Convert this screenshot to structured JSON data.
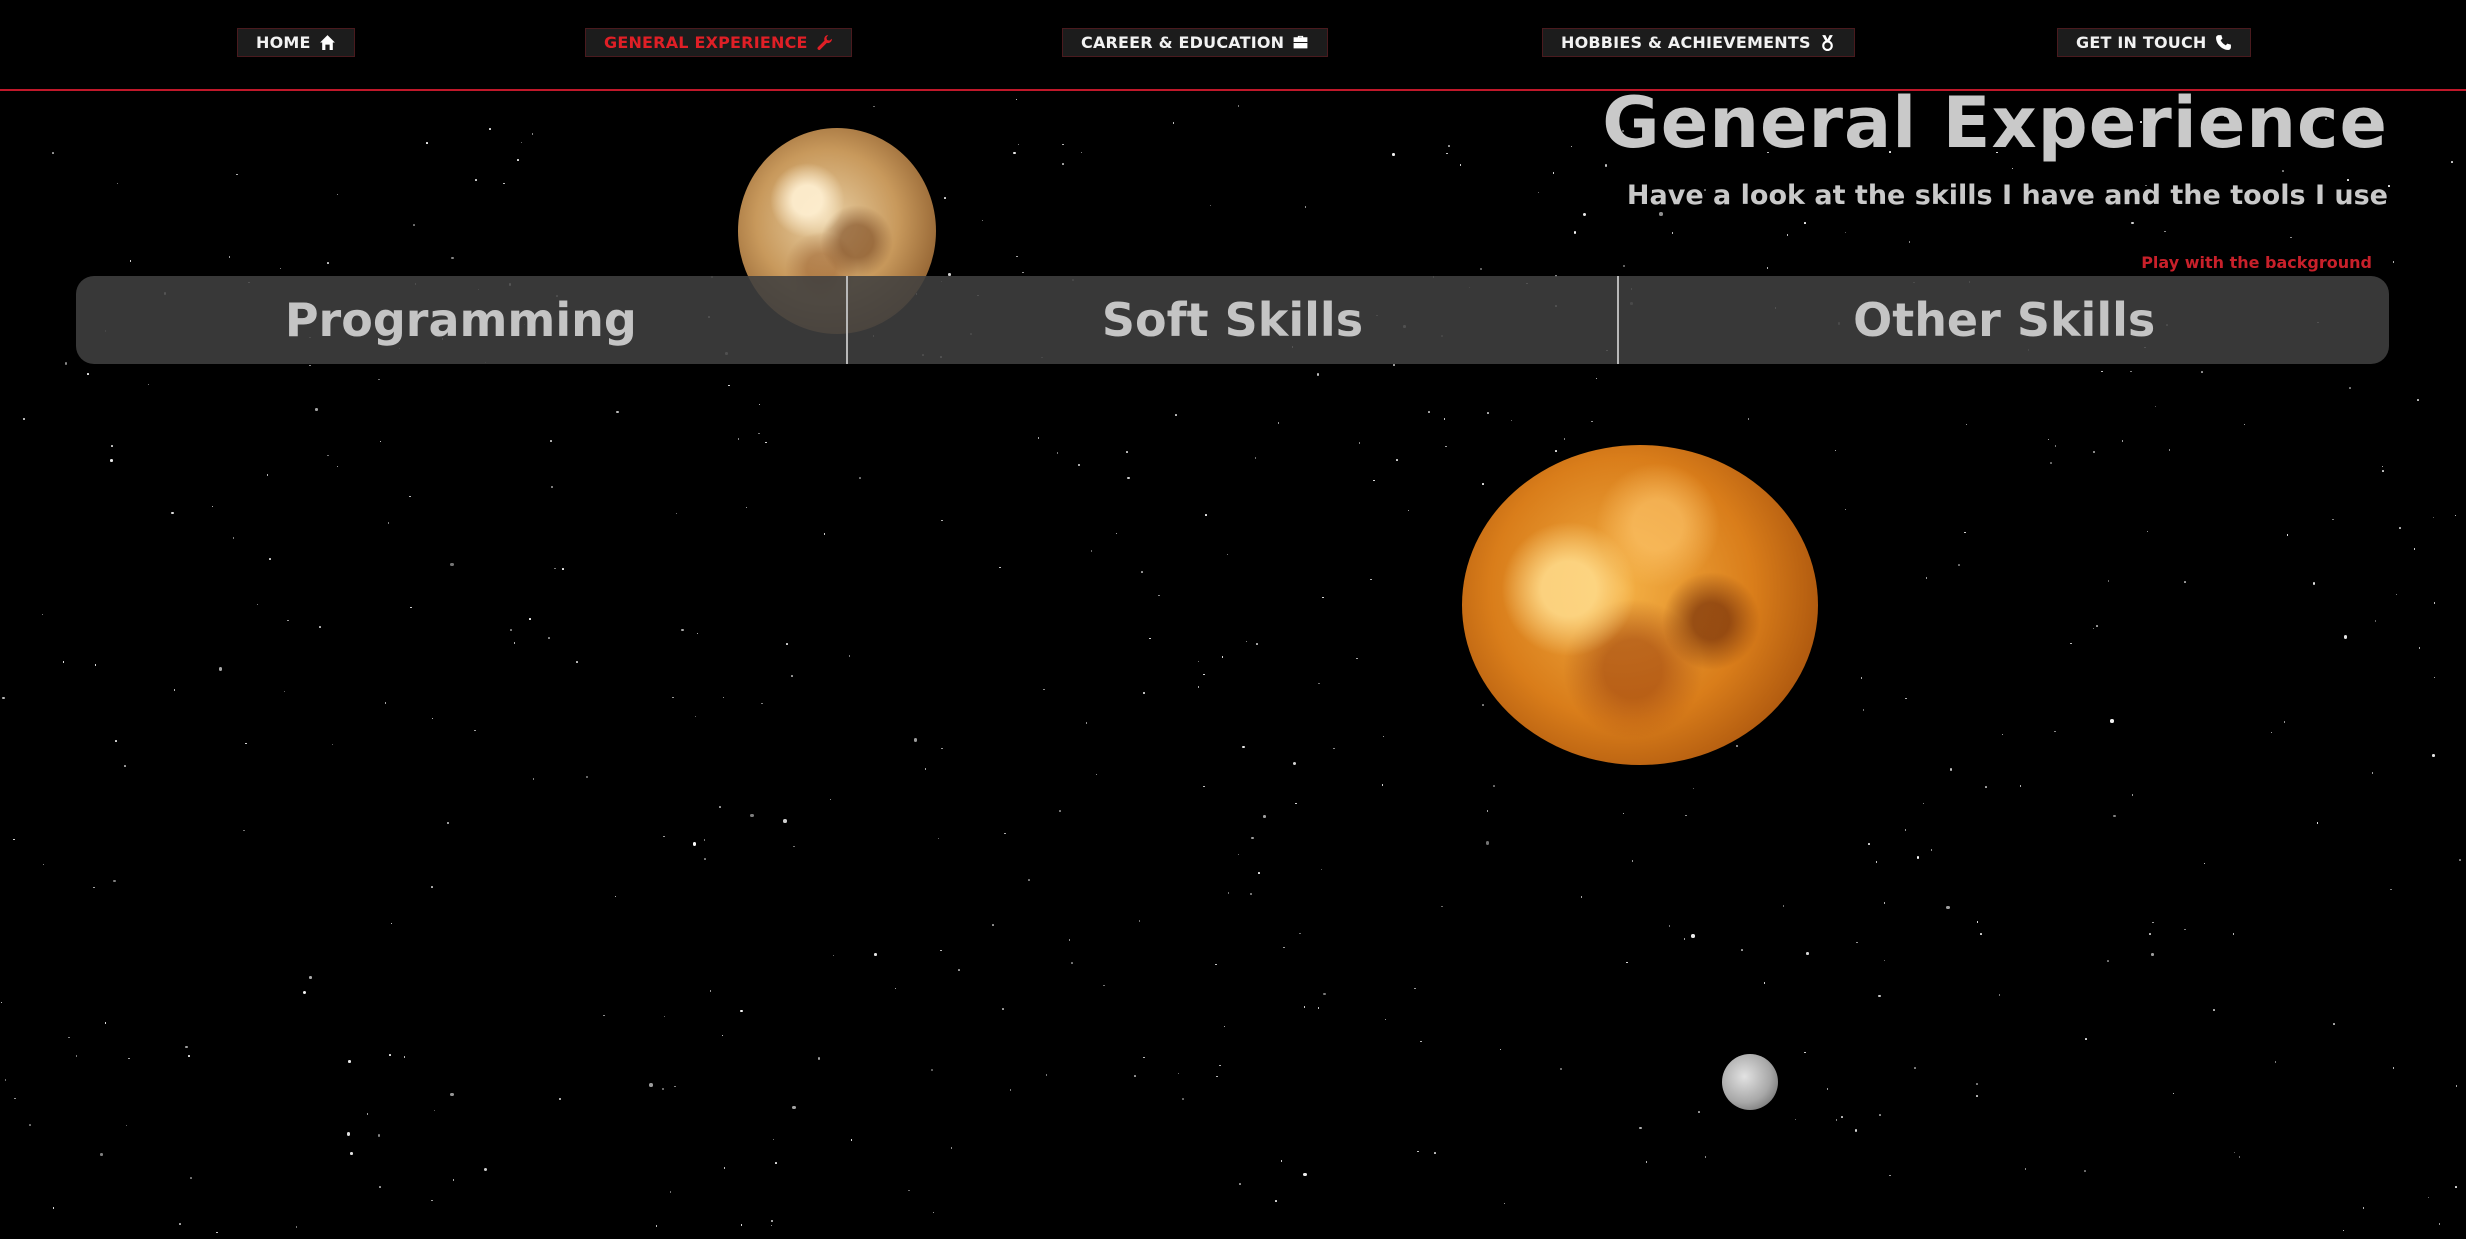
{
  "nav": {
    "items": [
      {
        "label": "HOME",
        "icon": "home-icon",
        "active": false
      },
      {
        "label": "GENERAL EXPERIENCE",
        "icon": "wrench-icon",
        "active": true
      },
      {
        "label": "CAREER & EDUCATION",
        "icon": "briefcase-icon",
        "active": false
      },
      {
        "label": "HOBBIES & ACHIEVEMENTS",
        "icon": "medal-icon",
        "active": false
      },
      {
        "label": "GET IN TOUCH",
        "icon": "phone-icon",
        "active": false
      }
    ]
  },
  "header": {
    "title": "General Experience",
    "subtitle": "Have a look at the skills I have and the tools I use",
    "background_link": "Play with the background"
  },
  "tabs": [
    {
      "label": "Programming"
    },
    {
      "label": "Soft Skills"
    },
    {
      "label": "Other Skills"
    }
  ],
  "colors": {
    "accent": "#e01f26",
    "nav_border": "#c0182a",
    "heading": "#c9c9c9",
    "background": "#000000",
    "tab_bar": "#404040"
  }
}
